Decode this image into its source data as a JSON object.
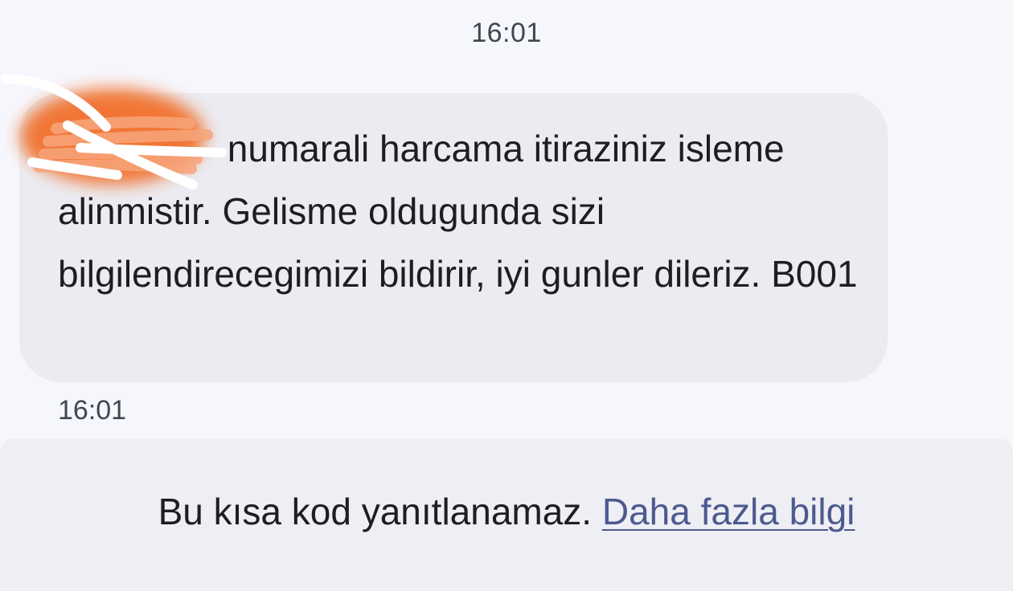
{
  "conversation": {
    "timestamp_top": "16:01",
    "message": {
      "text_line_1": "numarali harcama itiraziniz isleme",
      "text_rest": "alinmistir. Gelisme oldugunda sizi bilgilendirecegimizi bildirir, iyi gunler dileriz. B001",
      "timestamp": "16:01",
      "redaction_color": "#f26a23"
    }
  },
  "footer": {
    "notice": "Bu kısa kod yanıtlanamaz.",
    "link": "Daha fazla bilgi",
    "link_color": "#4d5a8f"
  }
}
